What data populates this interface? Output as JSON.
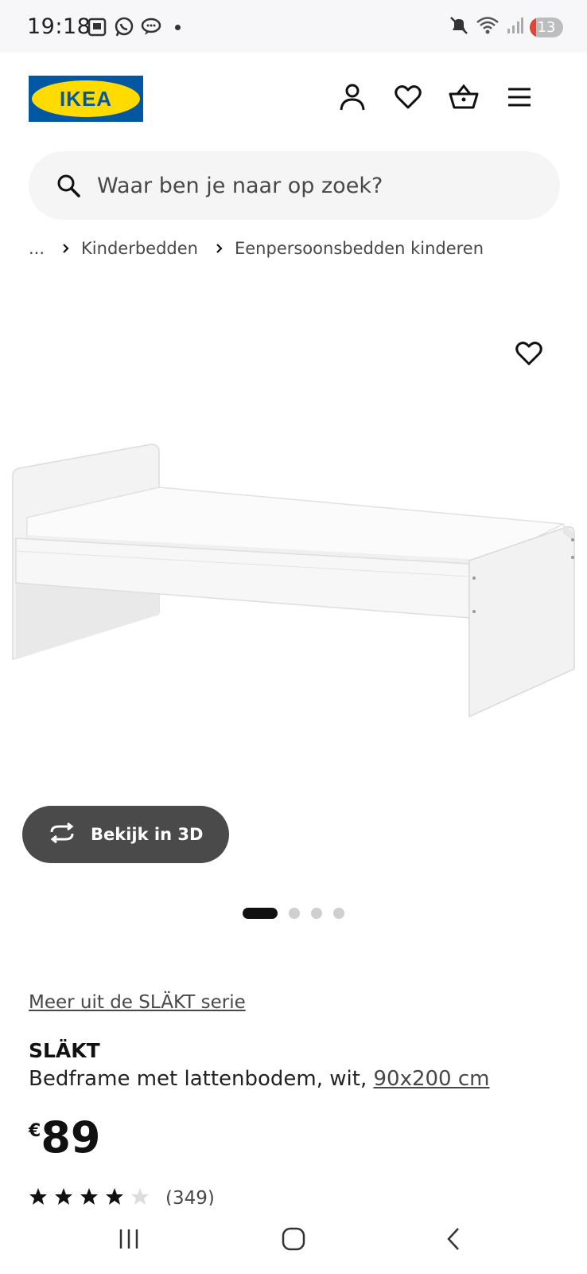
{
  "status_bar": {
    "time": "19:18",
    "battery": "13",
    "icons_left": [
      "screenshot-icon",
      "whatsapp-icon",
      "messages-icon",
      "notification-dot"
    ],
    "icons_right": [
      "mute-icon",
      "wifi-icon",
      "signal-icon",
      "battery-icon"
    ]
  },
  "header": {
    "logo_text": "IKEA",
    "logo_colors": {
      "blue": "#0058a3",
      "yellow": "#ffdb00"
    },
    "icons": [
      "account-icon",
      "favorites-icon",
      "cart-icon",
      "menu-icon"
    ]
  },
  "search": {
    "placeholder": "Waar ben je naar op zoek?"
  },
  "breadcrumb": {
    "ellipsis": "...",
    "items": [
      "Kinderbedden",
      "Eenpersoonsbedden kinderen"
    ]
  },
  "gallery": {
    "view_3d_label": "Bekijk in 3D",
    "image_count": 4,
    "active_index": 0
  },
  "product": {
    "series_link": "Meer uit de SLÄKT serie",
    "name": "SLÄKT",
    "description": "Bedframe met lattenbodem, wit,",
    "size": "90x200 cm",
    "currency": "€",
    "price": "89",
    "rating": 4,
    "rating_max": 5,
    "review_count": "(349)"
  },
  "nav_bar": {
    "buttons": [
      "recent-apps-icon",
      "home-icon",
      "back-icon"
    ]
  }
}
